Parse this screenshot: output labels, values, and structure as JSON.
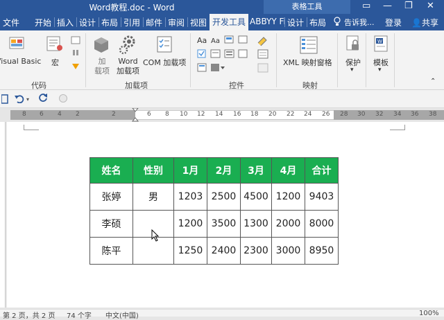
{
  "window": {
    "title": "Word教程.doc - Word",
    "context_title": "表格工具",
    "controls": [
      "▭",
      "—",
      "❐",
      "✕"
    ]
  },
  "tabs": [
    "文件",
    "开始",
    "插入",
    "设计",
    "布局",
    "引用",
    "邮件",
    "审阅",
    "视图",
    "开发工具",
    "ABBYY Fi",
    "设计",
    "布局"
  ],
  "tellme": "告诉我...",
  "login": "登录",
  "share": "共享",
  "ribbon": {
    "visual_basic": "Visual Basic",
    "macro": "宏",
    "group_code": "代码",
    "addin": "加\n载项",
    "word_addin": "Word\n加载项",
    "com_addin": "COM 加载项",
    "group_addins": "加载项",
    "group_controls": "控件",
    "xml_mapping": "XML 映射窗格",
    "group_mapping": "映射",
    "protect": "保护",
    "template": "模板",
    "design_mode": "设计模式"
  },
  "ruler_ticks": [
    "8",
    "6",
    "4",
    "2",
    "2",
    "6",
    "8",
    "10",
    "12",
    "14",
    "16",
    "18",
    "20",
    "22",
    "24",
    "26",
    "28",
    "30",
    "32",
    "34",
    "36",
    "38"
  ],
  "table": {
    "headers": [
      "姓名",
      "性别",
      "1月",
      "2月",
      "3月",
      "4月",
      "合计"
    ],
    "rows": [
      [
        "张婷",
        "男",
        "1203",
        "2500",
        "4500",
        "1200",
        "9403"
      ],
      [
        "李硕",
        "",
        "1200",
        "3500",
        "1300",
        "2000",
        "8000"
      ],
      [
        "陈平",
        "",
        "1250",
        "2400",
        "2300",
        "3000",
        "8950"
      ]
    ],
    "header_color": "#1aae51"
  },
  "status": {
    "page": "第 2 页，共 2 页",
    "words": "74 个字",
    "lang": "中文(中国)",
    "zoom": "100%"
  }
}
